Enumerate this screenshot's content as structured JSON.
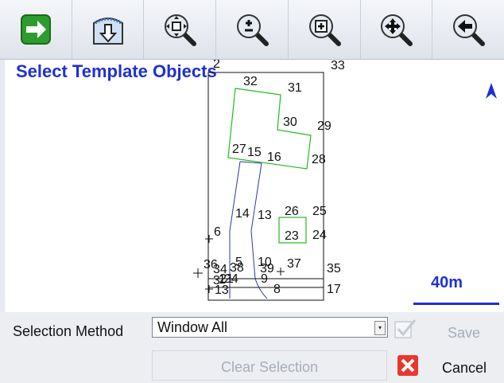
{
  "toolbar": {
    "buttons": [
      {
        "name": "next-icon"
      },
      {
        "name": "download-icon"
      },
      {
        "name": "zoom-extent-icon"
      },
      {
        "name": "zoom-in-out-icon"
      },
      {
        "name": "zoom-window-icon"
      },
      {
        "name": "pan-icon"
      },
      {
        "name": "back-icon"
      }
    ]
  },
  "map": {
    "title": "Select Template Objects",
    "scale_label": "40m",
    "north_icon": "north-arrow-icon",
    "point_labels": [
      "33",
      "2",
      "32",
      "31",
      "30",
      "29",
      "27",
      "15",
      "16",
      "28",
      "26",
      "25",
      "14",
      "13",
      "6",
      "23",
      "24",
      "36",
      "34",
      "38",
      "5",
      "10",
      "39",
      "37",
      "35",
      "3",
      "1",
      "21",
      "24",
      "13",
      "8",
      "17",
      "9"
    ]
  },
  "bottom": {
    "selection_method_label": "Selection Method",
    "selection_method_value": "Window All",
    "save_label": "Save",
    "clear_selection_label": "Clear Selection",
    "cancel_label": "Cancel"
  },
  "colors": {
    "title_blue": "#1f2fd6",
    "selected_green": "#22bb22",
    "line_blue": "#2a3aa8",
    "cancel_red": "#e8382e"
  }
}
